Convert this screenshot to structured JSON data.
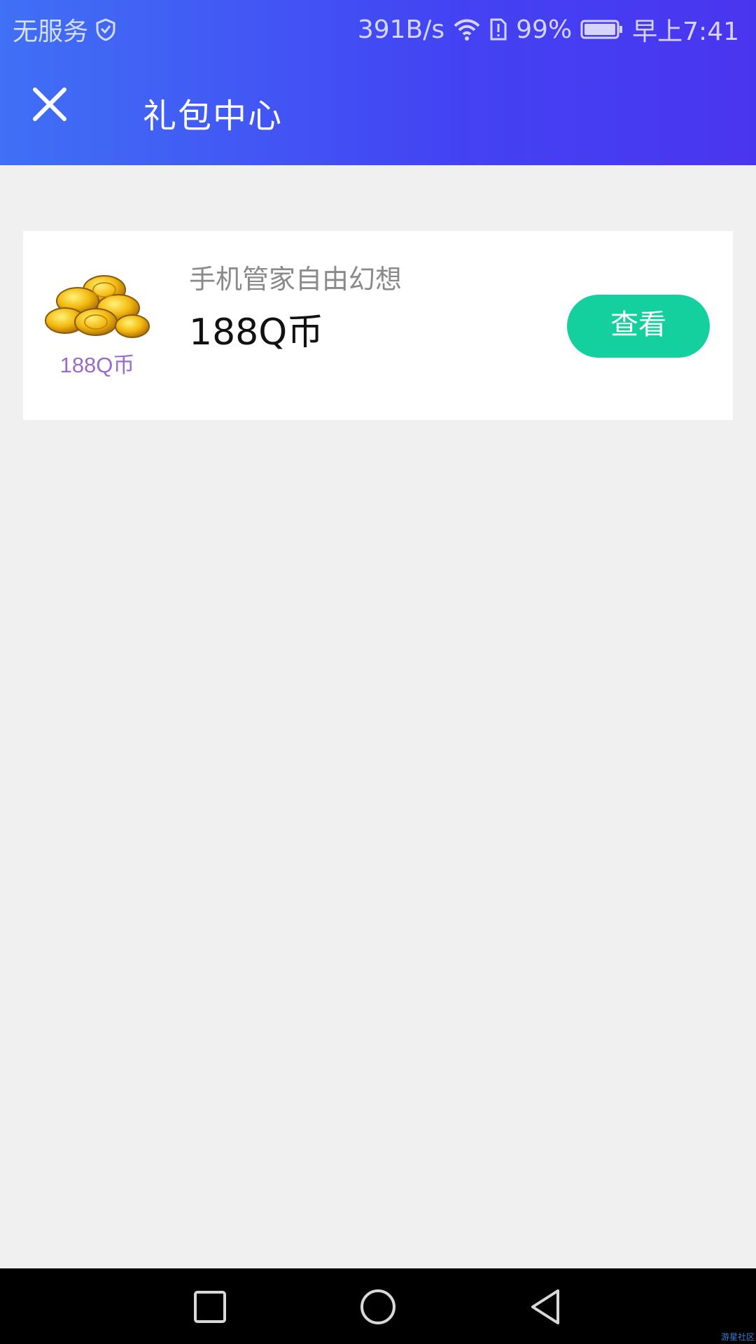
{
  "status_bar": {
    "carrier": "无服务",
    "net_speed": "391B/s",
    "battery_percent": "99%",
    "time": "早上7:41",
    "icons": [
      "shield-icon",
      "wifi-icon",
      "sim-alert-icon",
      "battery-icon"
    ]
  },
  "header": {
    "title": "礼包中心",
    "close_icon": "close-icon"
  },
  "gift_list": [
    {
      "image_label": "188Q币",
      "source": "手机管家自由幻想",
      "name": "188Q币",
      "button_label": "查看"
    }
  ],
  "nav_bar": {
    "icons": [
      "recent-apps-icon",
      "home-icon",
      "back-icon"
    ]
  },
  "watermark": "游星社区",
  "colors": {
    "header_gradient_start": "#4070f5",
    "header_gradient_end": "#4a35ef",
    "button": "#13d09e",
    "background": "#f0f0f0",
    "image_label": "#9b6bc9"
  }
}
